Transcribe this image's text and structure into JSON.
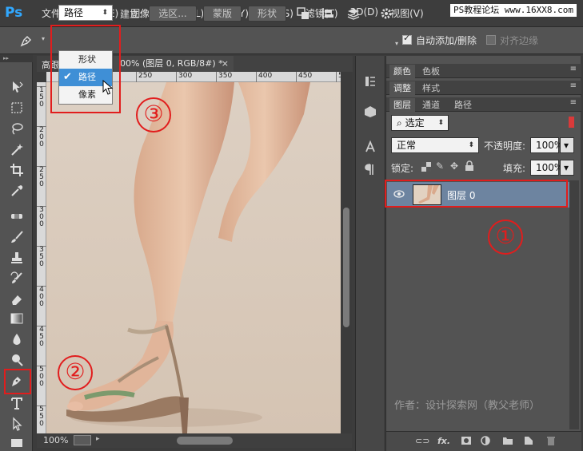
{
  "menubar": {
    "logo": "Ps",
    "items": [
      "文件(F)",
      "编辑(E)",
      "图像(I)",
      "图层(L)",
      "类型(Y)",
      "选择(S)",
      "滤镜(T)",
      "3D(D)",
      "视图(V)"
    ],
    "watermark": "PS教程论坛 www.16XX8.com"
  },
  "options": {
    "mode_value": "路径",
    "make_label": "建立:",
    "selection_btn": "选区...",
    "mask_btn": "蒙版",
    "shape_btn": "形状",
    "auto_add_label": "自动添加/删除",
    "auto_add_checked": true,
    "align_label": "对齐边缘",
    "align_checked": false
  },
  "mode_dropdown": {
    "items": [
      "形状",
      "路径",
      "像素"
    ],
    "selected": "路径"
  },
  "document": {
    "tab_prefix": "高跟",
    "tab_title": "00% (图层 0, RGB/8#) *",
    "tab_close": "×",
    "ruler_top": [
      "250",
      "300",
      "350",
      "400",
      "450",
      "5"
    ],
    "ruler_left": [
      "1\n5\n0",
      "2\n0\n0",
      "2\n5\n0",
      "3\n0\n0",
      "3\n5\n0",
      "4\n0\n0",
      "4\n5\n0",
      "5\n0\n0",
      "5\n5\n0"
    ],
    "zoom": "100%"
  },
  "panels": {
    "row1_tabs": [
      "颜色",
      "色板"
    ],
    "row2_tabs": [
      "调整",
      "样式"
    ],
    "row3_tabs": [
      "图层",
      "通道",
      "路径"
    ],
    "filter_kind": "选定",
    "blend_mode": "正常",
    "opacity_label": "不透明度:",
    "opacity_value": "100%",
    "lock_label": "锁定:",
    "fill_label": "填充:",
    "fill_value": "100%",
    "layer_name": "图层 0",
    "author": "作者：设计探索网（教父老师）",
    "footer_icons": [
      "link-icon",
      "fx-icon",
      "mask-icon",
      "adjustment-icon",
      "folder-icon",
      "new-layer-icon",
      "trash-icon"
    ],
    "footer_fx": "fx."
  },
  "annotations": {
    "one": "①",
    "two": "②",
    "three": "③",
    "color": "#e11d1d"
  }
}
